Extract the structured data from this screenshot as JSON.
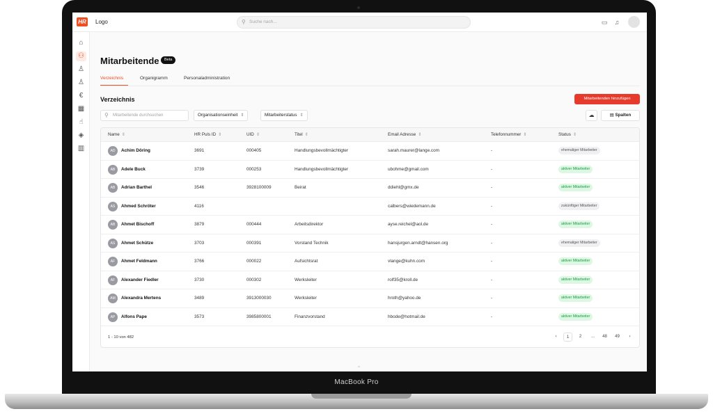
{
  "device": {
    "label": "MacBook Pro"
  },
  "topbar": {
    "logo_badge": "HR",
    "logo_text": "Logo",
    "search_placeholder": "Suche nach..."
  },
  "page": {
    "title": "Mitarbeitende",
    "badge": "Beta",
    "tabs": [
      {
        "label": "Verzeichnis",
        "active": true
      },
      {
        "label": "Organigramm",
        "active": false
      },
      {
        "label": "Personaladministration",
        "active": false
      }
    ]
  },
  "section": {
    "title": "Verzeichnis",
    "add_button": "Mitarbeitenden hinzufügen",
    "filter_placeholder": "Mitarbeitende durchsuchen",
    "dropdowns": [
      "Organisationseinheit",
      "Mitarbeiterstatus"
    ],
    "columns_button": "Spalten"
  },
  "table": {
    "headers": [
      "Name",
      "HR Puls ID",
      "UID",
      "Titel",
      "Email Adresse",
      "Telefonnummer",
      "Status"
    ],
    "rows": [
      {
        "initials": "AD",
        "name": "Achim Döring",
        "hr_id": "3691",
        "uid": "000405",
        "title": "Handlungsbevollmächtigter",
        "email": "sarah.maurer@lange.com",
        "phone": "-",
        "status": "ehemaliger Mitarbeiter",
        "status_type": "inactive"
      },
      {
        "initials": "AB",
        "name": "Adele Buck",
        "hr_id": "3739",
        "uid": "000253",
        "title": "Handlungsbevollmächtigter",
        "email": "ubohme@gmail.com",
        "phone": "-",
        "status": "aktiver Mitarbeiter",
        "status_type": "active"
      },
      {
        "initials": "AB",
        "name": "Adrian Barthel",
        "hr_id": "3546",
        "uid": "3928100009",
        "title": "Beirat",
        "email": "ddiehl@gmx.de",
        "phone": "-",
        "status": "aktiver Mitarbeiter",
        "status_type": "active"
      },
      {
        "initials": "AS",
        "name": "Ahmed Schröter",
        "hr_id": "4116",
        "uid": "",
        "title": "",
        "email": "calbers@wiedemann.de",
        "phone": "-",
        "status": "zukünftiger Mitarbeiter",
        "status_type": "future"
      },
      {
        "initials": "AB",
        "name": "Ahmet Bischoff",
        "hr_id": "3879",
        "uid": "000444",
        "title": "Arbeitsdirektor",
        "email": "ayse.reichel@aol.de",
        "phone": "-",
        "status": "aktiver Mitarbeiter",
        "status_type": "active"
      },
      {
        "initials": "AS",
        "name": "Ahmet Schütze",
        "hr_id": "3703",
        "uid": "000391",
        "title": "Vorstand Technik",
        "email": "hansjurgen.arndt@hansen.org",
        "phone": "-",
        "status": "ehemaliger Mitarbeiter",
        "status_type": "inactive"
      },
      {
        "initials": "AF",
        "name": "Ahmet Feldmann",
        "hr_id": "3766",
        "uid": "000022",
        "title": "Aufsichtsrat",
        "email": "vlange@kuhn.com",
        "phone": "-",
        "status": "aktiver Mitarbeiter",
        "status_type": "active"
      },
      {
        "initials": "AF",
        "name": "Alexander Fiedler",
        "hr_id": "3730",
        "uid": "000302",
        "title": "Werksleiter",
        "email": "rolf35@kroll.de",
        "phone": "-",
        "status": "aktiver Mitarbeiter",
        "status_type": "active"
      },
      {
        "initials": "AM",
        "name": "Alexandra Mertens",
        "hr_id": "3489",
        "uid": "3913000030",
        "title": "Werksleiter",
        "email": "hroth@yahoo.de",
        "phone": "-",
        "status": "aktiver Mitarbeiter",
        "status_type": "active"
      },
      {
        "initials": "AP",
        "name": "Alfons Pape",
        "hr_id": "3573",
        "uid": "3985800001",
        "title": "Finanzvorstand",
        "email": "hbode@hotmail.de",
        "phone": "-",
        "status": "aktiver Mitarbeiter",
        "status_type": "active"
      }
    ],
    "count_text": "1 - 10 von 482",
    "pagination": [
      "‹",
      "1",
      "2",
      "...",
      "48",
      "49",
      "›"
    ]
  },
  "colors": {
    "accent": "#ef4e23",
    "button": "#e53a2c",
    "active_badge": "#dcf8e3"
  }
}
